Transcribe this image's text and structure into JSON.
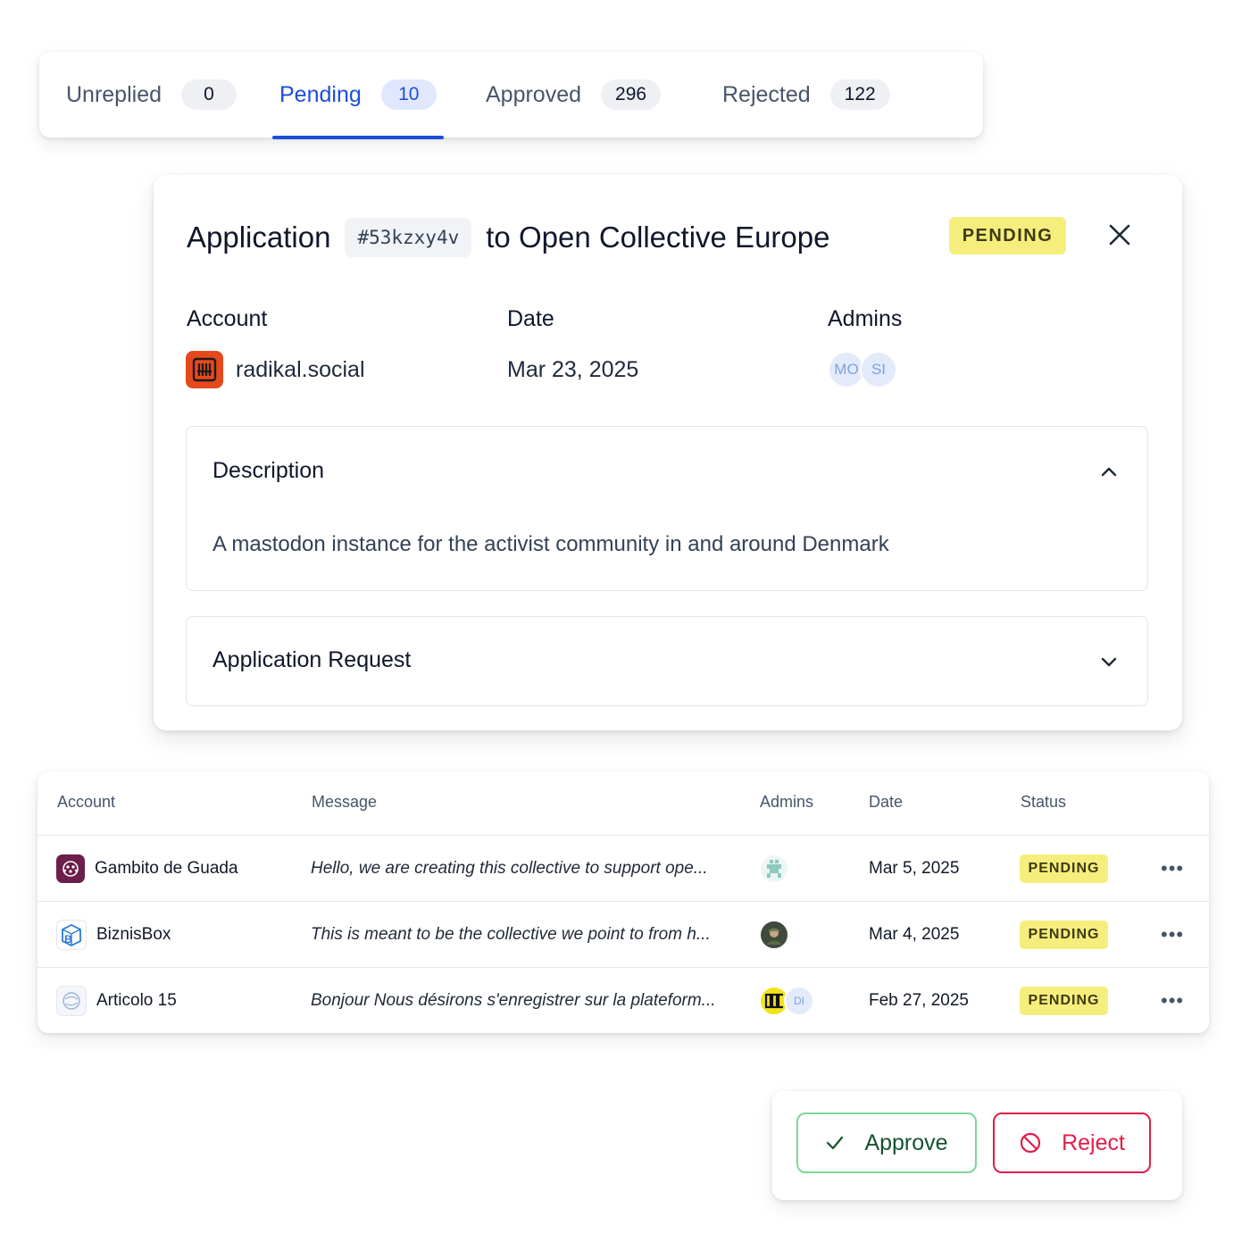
{
  "tabs": [
    {
      "label": "Unreplied",
      "count": "0"
    },
    {
      "label": "Pending",
      "count": "10"
    },
    {
      "label": "Approved",
      "count": "296"
    },
    {
      "label": "Rejected",
      "count": "122"
    }
  ],
  "active_tab": "Pending",
  "application": {
    "title_prefix": "Application",
    "id": "#53kzxy4v",
    "title_suffix": "to Open Collective Europe",
    "status": "PENDING",
    "account_label": "Account",
    "date_label": "Date",
    "admins_label": "Admins",
    "account": "radikal.social",
    "date": "Mar 23, 2025",
    "admins": [
      "MO",
      "SI"
    ],
    "description_title": "Description",
    "description": "A mastodon instance for the activist community in and around Denmark",
    "request_title": "Application Request"
  },
  "table": {
    "headers": {
      "account": "Account",
      "message": "Message",
      "admins": "Admins",
      "date": "Date",
      "status": "Status"
    },
    "rows": [
      {
        "account": "Gambito de Guada",
        "message": "Hello, we are creating this collective to support ope...",
        "date": "Mar 5, 2025",
        "status": "PENDING"
      },
      {
        "account": "BiznisBox",
        "message": "This is meant to be the collective we point to from h...",
        "date": "Mar 4, 2025",
        "status": "PENDING"
      },
      {
        "account": "Articolo 15",
        "message": "Bonjour Nous désirons s'enregistrer sur la plateform...",
        "date": "Feb 27, 2025",
        "status": "PENDING",
        "admin_initials": "DI"
      }
    ]
  },
  "actions": {
    "approve": "Approve",
    "reject": "Reject"
  },
  "colors": {
    "accent": "#1d4ed8",
    "pending_badge": "#f6ee7c",
    "approve_border": "#7dd69a",
    "reject": "#e11d48"
  }
}
